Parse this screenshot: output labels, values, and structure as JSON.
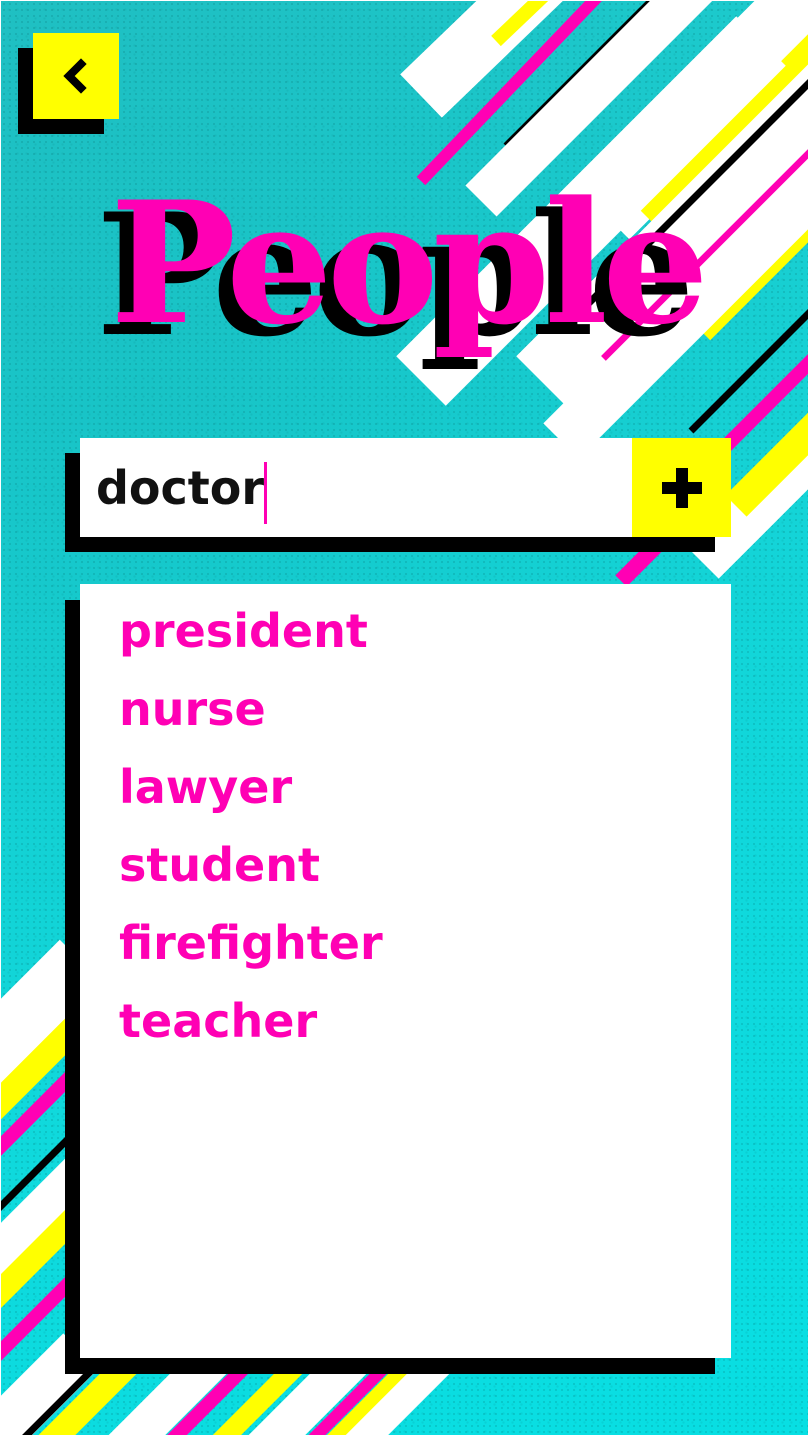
{
  "title": "People",
  "search": {
    "value": "doctor",
    "placeholder": ""
  },
  "buttons": {
    "back_icon": "chevron-left-icon",
    "add_icon": "plus-icon"
  },
  "suggestions": [
    "president",
    "nurse",
    "lawyer",
    "student",
    "firefighter",
    "teacher"
  ],
  "colors": {
    "background": "#14d5d8",
    "accent_pink": "#ff00b4",
    "accent_yellow": "#ffff00",
    "shadow": "#000000",
    "panel": "#ffffff"
  }
}
